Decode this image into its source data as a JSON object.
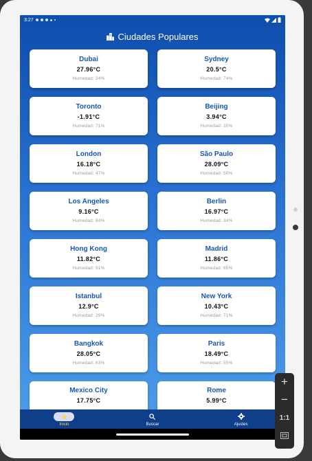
{
  "status_bar": {
    "time": "3:27"
  },
  "header": {
    "title": "Ciudades Populares",
    "icon": "city-icon"
  },
  "cities": [
    {
      "name": "Dubai",
      "temp": "27.96°C",
      "humidity": "Humedad: 24%"
    },
    {
      "name": "Sydney",
      "temp": "20.5°C",
      "humidity": "Humedad: 74%"
    },
    {
      "name": "Toronto",
      "temp": "-1.91°C",
      "humidity": "Humedad: 71%"
    },
    {
      "name": "Beijing",
      "temp": "3.94°C",
      "humidity": "Humedad: 20%"
    },
    {
      "name": "London",
      "temp": "16.18°C",
      "humidity": "Humedad: 47%"
    },
    {
      "name": "São Paulo",
      "temp": "28.09°C",
      "humidity": "Humedad: 50%"
    },
    {
      "name": "Los Angeles",
      "temp": "9.16°C",
      "humidity": "Humedad: 84%"
    },
    {
      "name": "Berlin",
      "temp": "16.97°C",
      "humidity": "Humedad: 34%"
    },
    {
      "name": "Hong Kong",
      "temp": "11.82°C",
      "humidity": "Humedad: 91%"
    },
    {
      "name": "Madrid",
      "temp": "11.86°C",
      "humidity": "Humedad: 65%"
    },
    {
      "name": "Istanbul",
      "temp": "12.9°C",
      "humidity": "Humedad: 29%"
    },
    {
      "name": "New York",
      "temp": "10.43°C",
      "humidity": "Humedad: 71%"
    },
    {
      "name": "Bangkok",
      "temp": "28.05°C",
      "humidity": "Humedad: 63%"
    },
    {
      "name": "Paris",
      "temp": "18.49°C",
      "humidity": "Humedad: 55%"
    },
    {
      "name": "Mexico City",
      "temp": "17.75°C",
      "humidity": ""
    },
    {
      "name": "Rome",
      "temp": "5.99°C",
      "humidity": ""
    }
  ],
  "bottom_nav": [
    {
      "label": "Inicio",
      "icon": "star-icon",
      "active": true
    },
    {
      "label": "Buscar",
      "icon": "search-icon",
      "active": false
    },
    {
      "label": "Ajustes",
      "icon": "gear-icon",
      "active": false
    }
  ],
  "emulator_toolbar": {
    "zoom_label": "1:1"
  },
  "colors": {
    "accent": "#1757b1",
    "nav_active": "#ffd54a",
    "nav_bg": "#0f3e8a"
  }
}
